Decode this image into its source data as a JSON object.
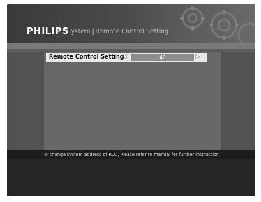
{
  "header": {
    "brand": "PHILIPS",
    "breadcrumb": [
      "System",
      "Remote Control Setting"
    ],
    "separator": "|"
  },
  "setting": {
    "label": "Remote Control Setting",
    "value": "40",
    "left_arrow_icon": "arrow-left-icon",
    "right_arrow_icon": "arrow-right-icon"
  },
  "info": {
    "message": "To change system address of RCU, Please refer to manual for further instruction"
  },
  "colors": {
    "background": "#2a2a2a",
    "panel": "#686868",
    "row_highlight": "#e8e8e8",
    "value_bar": "#8c8c8c"
  }
}
